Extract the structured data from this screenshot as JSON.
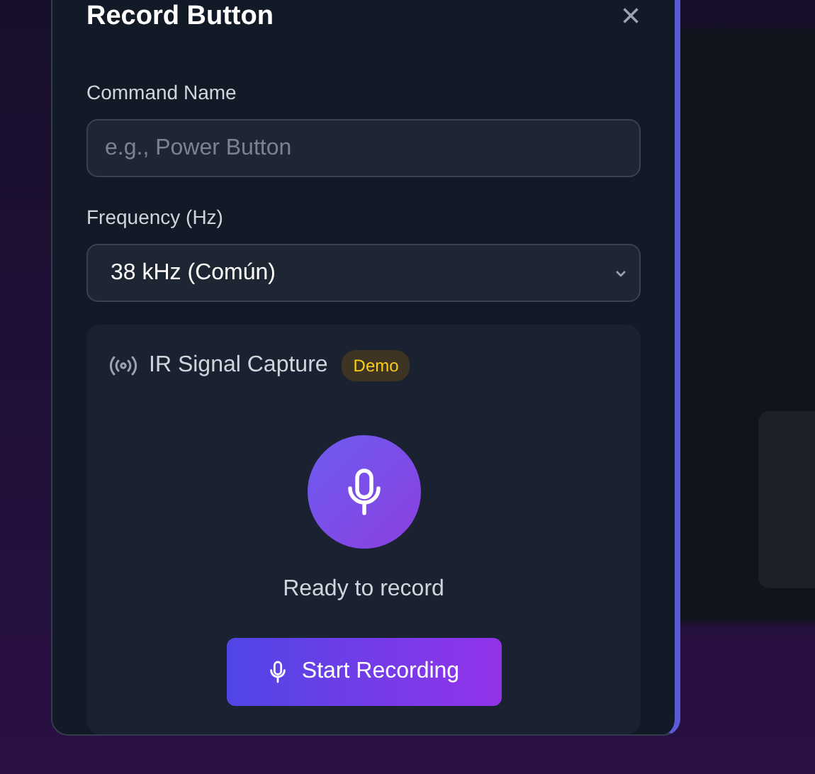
{
  "dialog": {
    "title": "Record Button",
    "close": "×"
  },
  "command_name": {
    "label": "Command Name",
    "placeholder": "e.g., Power Button"
  },
  "frequency": {
    "label": "Frequency (Hz)",
    "value": "38 kHz (Común)"
  },
  "capture": {
    "title": "IR Signal Capture",
    "badge": "Demo",
    "status": "Ready to record",
    "button": "Start Recording"
  }
}
